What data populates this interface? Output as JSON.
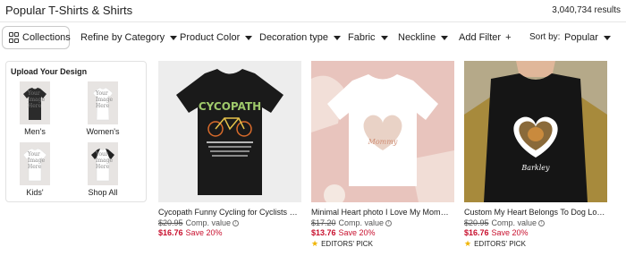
{
  "header": {
    "title": "Popular T-Shirts & Shirts",
    "results": "3,040,734 results"
  },
  "filters": {
    "collections": "Collections",
    "items": [
      "Refine by Category",
      "Product Color",
      "Decoration type",
      "Fabric",
      "Neckline",
      "Add Filter"
    ],
    "sort_label": "Sort by:",
    "sort_value": "Popular"
  },
  "upload": {
    "title": "Upload Your Design",
    "placeholder_text": "Your Image Here",
    "tiles": [
      {
        "label": "Men's",
        "shirt_color": "#2b2b2b"
      },
      {
        "label": "Women's",
        "shirt_color": "#ffffff"
      },
      {
        "label": "Kids'",
        "shirt_color": "#ffffff"
      },
      {
        "label": "Shop All",
        "shirt_color": "#ffffff"
      }
    ]
  },
  "products": [
    {
      "title": "Cycopath Funny Cycling for Cyclists and ...",
      "old_price": "$20.95",
      "comp": "Comp. value",
      "sale_price": "$16.76",
      "save": "Save 20%",
      "badge": "",
      "art_text": "CYCOPATH",
      "bg_color": "#ededed",
      "shirt_color": "#1a1a1a"
    },
    {
      "title": "Minimal Heart photo I Love My Mommy T...",
      "old_price": "$17.20",
      "comp": "Comp. value",
      "sale_price": "$13.76",
      "save": "Save 20%",
      "badge": "EDITORS' PICK",
      "art_text": "Mommy",
      "bg_color": "#e8c4bd",
      "shirt_color": "#ffffff"
    },
    {
      "title": "Custom My Heart Belongs To Dog Lover ...",
      "old_price": "$20.95",
      "comp": "Comp. value",
      "sale_price": "$16.76",
      "save": "Save 20%",
      "badge": "EDITORS' PICK",
      "art_text": "Barkley",
      "bg_color": "#b5a989",
      "shirt_color": "#151515"
    }
  ],
  "colors": {
    "sale": "#c8102e",
    "star": "#f0b400"
  }
}
